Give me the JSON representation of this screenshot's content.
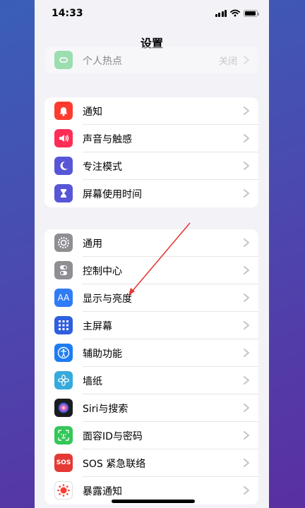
{
  "status": {
    "time": "14:33"
  },
  "nav": {
    "title": "设置"
  },
  "group0": [
    {
      "name": "hotspot",
      "label": "个人热点",
      "value": "关闭",
      "color": "#34c759",
      "icon": "link-icon"
    }
  ],
  "group1": [
    {
      "name": "notifications",
      "label": "通知",
      "color": "#ff3b30",
      "icon": "bell-icon"
    },
    {
      "name": "sounds",
      "label": "声音与触感",
      "color": "#ff2d55",
      "icon": "speaker-icon"
    },
    {
      "name": "focus",
      "label": "专注模式",
      "color": "#5856d6",
      "icon": "moon-icon"
    },
    {
      "name": "screen-time",
      "label": "屏幕使用时间",
      "color": "#5856d6",
      "icon": "hourglass-icon"
    }
  ],
  "group2": [
    {
      "name": "general",
      "label": "通用",
      "color": "#8e8e93",
      "icon": "gear-icon"
    },
    {
      "name": "control-center",
      "label": "控制中心",
      "color": "#8e8e93",
      "icon": "toggles-icon"
    },
    {
      "name": "display",
      "label": "显示与亮度",
      "color": "#2f7cf6",
      "icon": "aa-icon",
      "glyph": "AA"
    },
    {
      "name": "home-screen",
      "label": "主屏幕",
      "color": "#2f5fe0",
      "icon": "grid-icon"
    },
    {
      "name": "accessibility",
      "label": "辅助功能",
      "color": "#1e7cf2",
      "icon": "accessibility-icon"
    },
    {
      "name": "wallpaper",
      "label": "墙纸",
      "color": "#35aadc",
      "icon": "flower-icon"
    },
    {
      "name": "siri",
      "label": "Siri与搜索",
      "color": "#1c1c1e",
      "icon": "siri-icon"
    },
    {
      "name": "face-id",
      "label": "面容ID与密码",
      "color": "#34c759",
      "icon": "face-id-icon"
    },
    {
      "name": "sos",
      "label": "SOS 紧急联络",
      "color": "#e53935",
      "icon": "sos-icon",
      "glyph": "SOS"
    },
    {
      "name": "exposure",
      "label": "暴露通知",
      "color": "#ffffff",
      "icon": "exposure-icon"
    }
  ]
}
